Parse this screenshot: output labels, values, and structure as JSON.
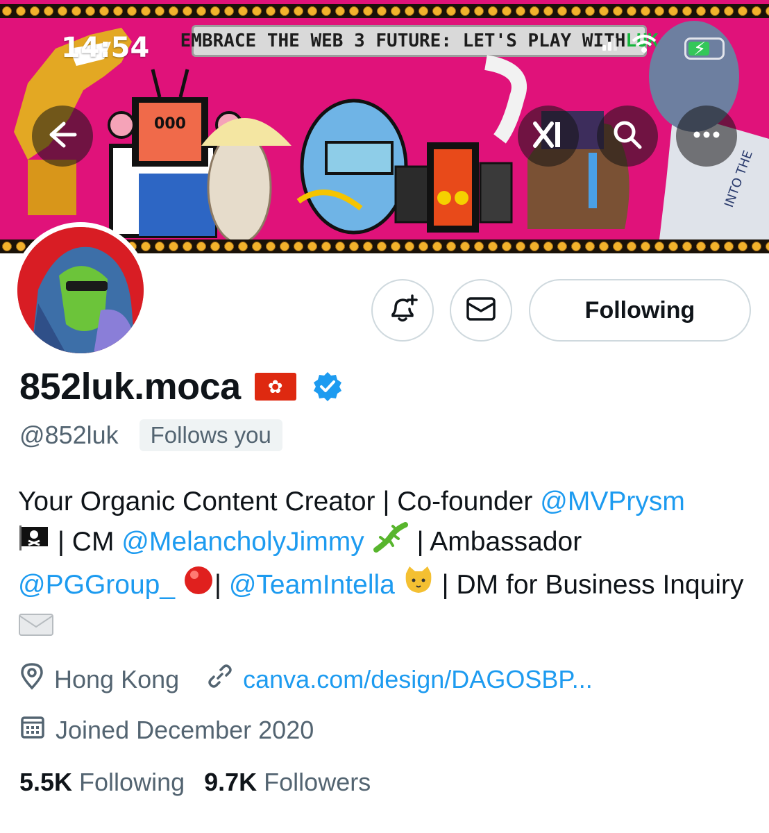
{
  "status_bar": {
    "time": "14:54"
  },
  "banner": {
    "headline": "EMBRACE THE WEB 3 FUTURE: LET'S PLAY WITH ",
    "headline_accent": "LUK",
    "tv_face": "000",
    "hoodie_text": "INTO THE"
  },
  "nav": {
    "back_icon": "arrow-left-icon",
    "grok_icon": "x-grok-icon",
    "search_icon": "search-icon",
    "more_icon": "more-horizontal-icon"
  },
  "actions": {
    "notify_icon": "bell-plus-icon",
    "message_icon": "envelope-icon",
    "follow_label": "Following"
  },
  "profile": {
    "display_name": "852luk.moca",
    "handle": "@852luk",
    "follows_you": "Follows you",
    "bio": {
      "t1": "Your Organic Content Creator | Co-founder ",
      "m1": "@MVPrysm",
      "t2": " | CM ",
      "m2": "@MelancholyJimmy",
      "t3": " | Ambassador ",
      "m3": "@PGGroup_",
      "t4": "| ",
      "m4": "@TeamIntella",
      "t5": " | DM for Business Inquiry"
    },
    "location": "Hong Kong",
    "website": "canva.com/design/DAGOSBP...",
    "joined": "Joined December 2020"
  },
  "stats": {
    "following_count": "5.5K",
    "following_label": "Following",
    "followers_count": "9.7K",
    "followers_label": "Followers"
  },
  "colors": {
    "banner_bg": "#e0127a",
    "accent_blue": "#1d9bf0",
    "secondary_text": "#536471",
    "verified_blue": "#1d9bf0"
  }
}
